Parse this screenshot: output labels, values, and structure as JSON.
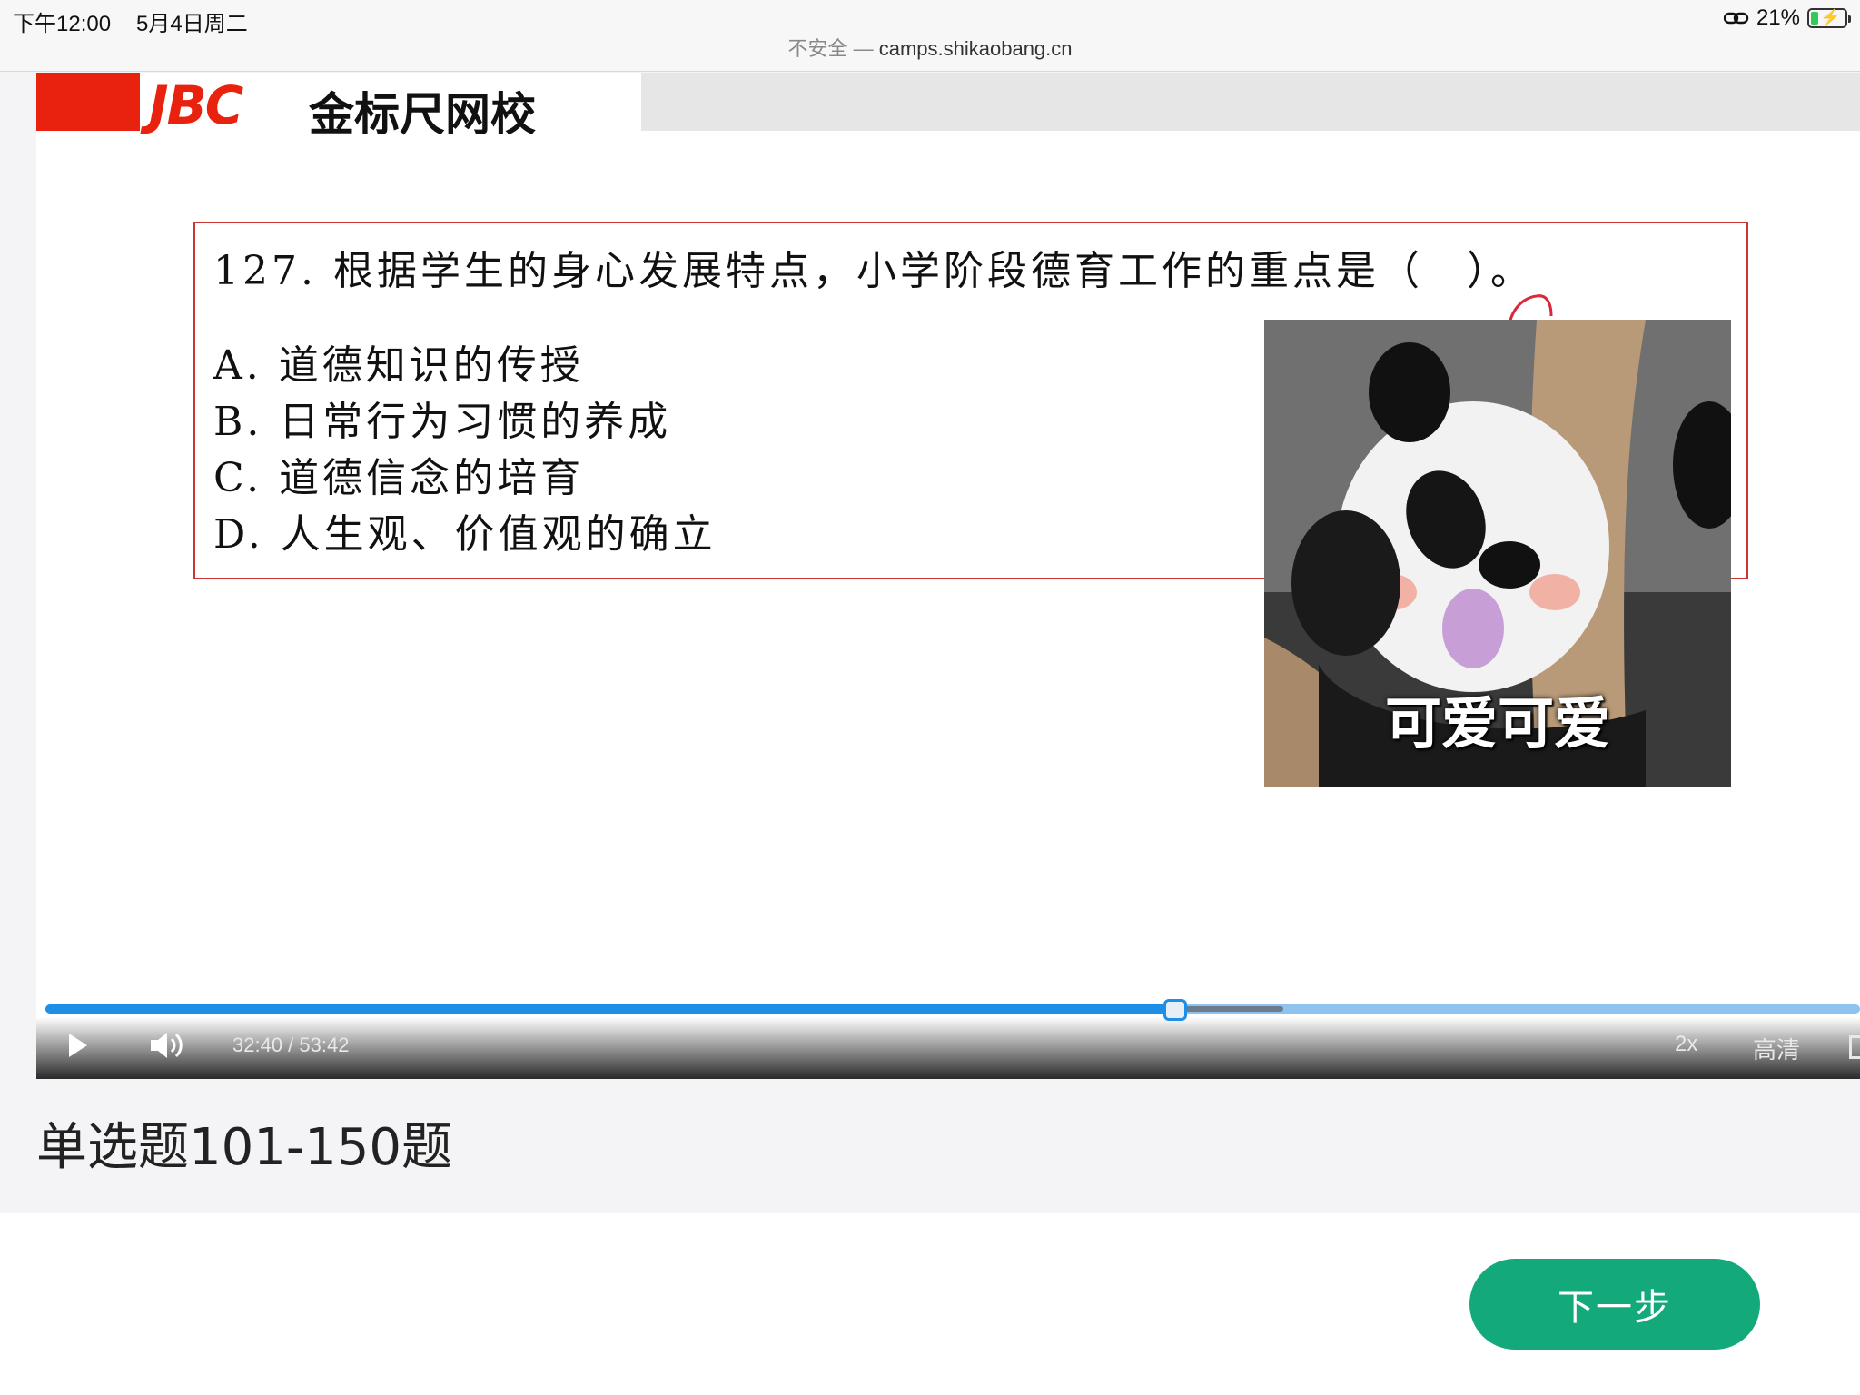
{
  "status_bar": {
    "time": "下午12:00",
    "date": "5月4日周二",
    "battery": "21%"
  },
  "url_bar": {
    "security": "不安全",
    "separator": " — ",
    "domain": "camps.shikaobang.cn"
  },
  "video": {
    "logo": {
      "mark": "JBC",
      "name": "金标尺网校"
    },
    "question": {
      "text": "127. 根据学生的身心发展特点，小学阶段德育工作的重点是（　）。",
      "options": [
        "A. 道德知识的传授",
        "B. 日常行为习惯的养成",
        "C. 道德信念的培育",
        "D. 人生观、价值观的确立"
      ]
    },
    "sticker": {
      "caption": "可爱可爱"
    },
    "controls": {
      "time": "32:40 / 53:42",
      "progress": 0.6224,
      "buffered": 0.682,
      "speed": "2x",
      "quality": "高清"
    }
  },
  "lesson": {
    "title": "单选题101-150题"
  },
  "actions": {
    "next_label": "下一步"
  },
  "colors": {
    "brand_red": "#e8220e",
    "progress_blue": "#1d8fe6",
    "button_green": "#14a97b"
  }
}
